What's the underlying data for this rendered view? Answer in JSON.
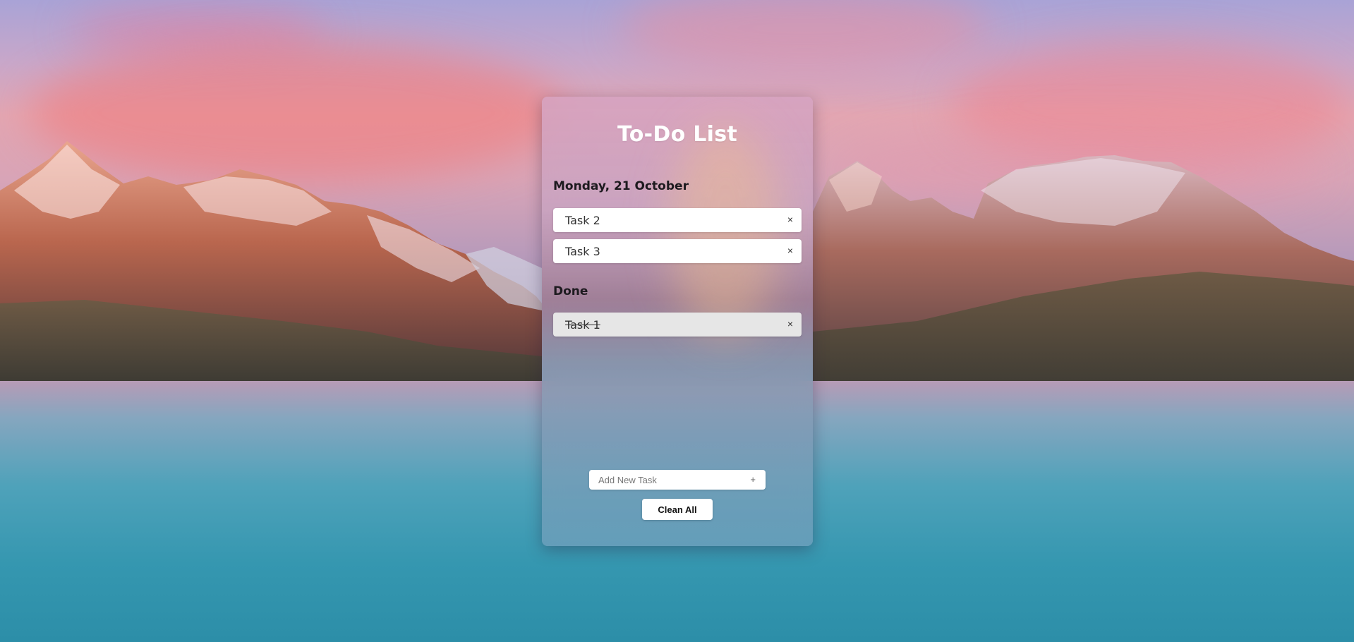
{
  "app": {
    "title": "To-Do List"
  },
  "sections": {
    "today": {
      "heading": "Monday, 21 October",
      "tasks": [
        {
          "text": "Task 2",
          "remove": "×"
        },
        {
          "text": "Task 3",
          "remove": "×"
        }
      ]
    },
    "done": {
      "heading": "Done",
      "tasks": [
        {
          "text": "Task 1",
          "remove": "×"
        }
      ]
    }
  },
  "add_task": {
    "placeholder": "Add New Task",
    "button": "+"
  },
  "clean_all": {
    "label": "Clean All"
  },
  "icons": {
    "remove": "close-icon",
    "add": "plus-icon"
  },
  "colors": {
    "title": "#ffffff",
    "task_background": "#ffffff",
    "done_task_background": "#e6e6e6",
    "heading_text": "#1d1a1f"
  }
}
